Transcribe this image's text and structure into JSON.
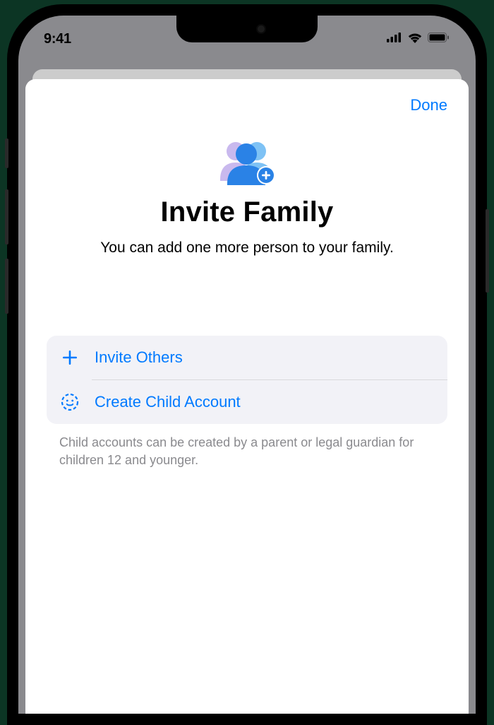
{
  "status": {
    "time": "9:41"
  },
  "header": {
    "done_label": "Done"
  },
  "hero": {
    "title": "Invite Family",
    "subtitle": "You can add one more person to your family."
  },
  "options": {
    "invite_label": "Invite Others",
    "create_child_label": "Create Child Account"
  },
  "footer": {
    "note": "Child accounts can be created by a parent or legal guardian for children 12 and younger."
  },
  "colors": {
    "accent": "#007AFF"
  }
}
